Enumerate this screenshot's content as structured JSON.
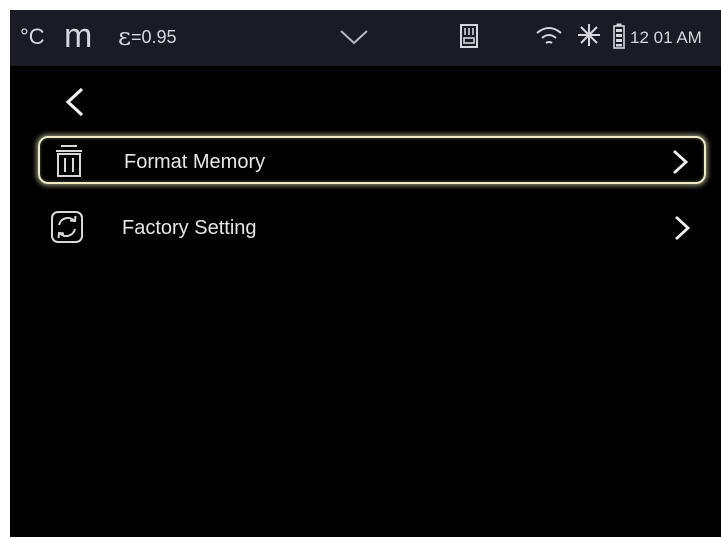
{
  "status_bar": {
    "temperature_unit": "°C",
    "distance_unit": "m",
    "emissivity_symbol": "ε",
    "emissivity_value": "=0.95",
    "time": "12 01 AM",
    "icons": [
      "chevron-down-icon",
      "sd-card-icon",
      "wifi-icon",
      "sun-icon",
      "battery-icon"
    ]
  },
  "nav": {
    "back_icon": "back-arrow-icon"
  },
  "menu": {
    "items": [
      {
        "label": "Format Memory",
        "icon": "trash-icon",
        "selected": true
      },
      {
        "label": "Factory Setting",
        "icon": "reset-icon",
        "selected": false
      }
    ]
  },
  "colors": {
    "background": "#000000",
    "status_bar": "#1b1b24",
    "text": "#e6e6e6",
    "selection_border": "#ecebc4"
  }
}
